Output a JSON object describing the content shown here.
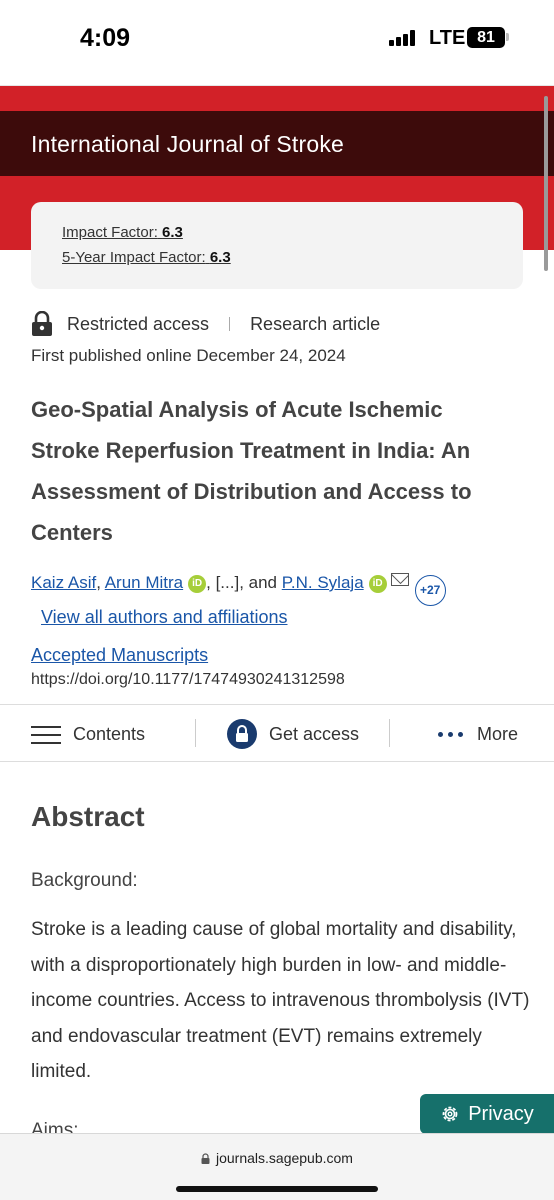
{
  "status_bar": {
    "time": "4:09",
    "network": "LTE",
    "battery": "81"
  },
  "journal": {
    "title": "International Journal of Stroke"
  },
  "impact": {
    "label": "Impact Factor:",
    "value": "6.3",
    "five_year_label": "5-Year Impact Factor:",
    "five_year_value": "6.3"
  },
  "article": {
    "access": "Restricted access",
    "type": "Research article",
    "published": "First published online December 24, 2024",
    "title": "Geo-Spatial Analysis of Acute Ischemic Stroke Reperfusion Treatment in India: An Assessment of Distribution and Access to Centers",
    "authors": [
      "Kaiz Asif",
      "Arun Mitra",
      "P.N. Sylaja"
    ],
    "orcid_label": "iD",
    "author_sep_1": ", ",
    "author_ellipsis": ", [...], and ",
    "more_authors": "+27",
    "view_all": "View all authors and affiliations",
    "collection": "Accepted Manuscripts",
    "doi": "https://doi.org/10.1177/17474930241312598"
  },
  "toolbar": {
    "contents": "Contents",
    "get_access": "Get access",
    "more": "More"
  },
  "abstract": {
    "heading": "Abstract",
    "background_label": "Background:",
    "background_text": "Stroke is a leading cause of global mortality and disability, with a disproportionately high burden in low- and middle-income countries. Access to intravenous thrombolysis (IVT) and endovascular treatment (EVT) remains extremely limited.",
    "aims_label": "Aims:"
  },
  "privacy_button": "Privacy",
  "url_bar": {
    "domain": "journals.sagepub.com"
  },
  "colors": {
    "brand_red": "#d22128",
    "journal_bar": "#3d0b0b",
    "link_blue": "#1a56a8",
    "privacy_teal": "#16706b",
    "orcid_green": "#a6ce39"
  }
}
